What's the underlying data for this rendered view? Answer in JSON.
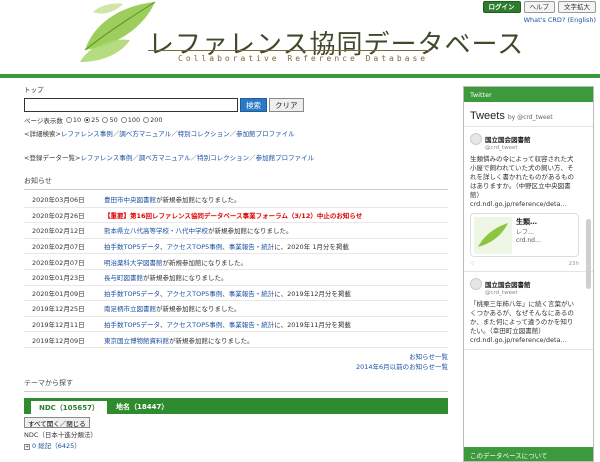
{
  "header": {
    "title": "レファレンス協同データベース",
    "subtitle": "Collaborative Reference Database",
    "login_label": "ログイン",
    "help_label": "ヘルプ",
    "font_size_label": "文字拡大",
    "whats_crd": "What's CRD? (English)"
  },
  "breadcrumb": "トップ",
  "search": {
    "placeholder": "",
    "search_label": "検索",
    "clear_label": "クリア",
    "per_page_label": "ページ表示数",
    "per_page_options": [
      "10",
      "25",
      "50",
      "100",
      "200"
    ],
    "per_page_selected": "25"
  },
  "detail_search": {
    "prefix": "<詳細検索>",
    "links": [
      "レファレンス事例",
      "調べ方マニュアル",
      "特別コレクション",
      "参加館プロファイル"
    ]
  },
  "register_data": {
    "prefix": "<登録データ一覧>",
    "links": [
      "レファレンス事例",
      "調べ方マニュアル",
      "特別コレクション",
      "参加館プロファイル"
    ]
  },
  "news": {
    "title": "お知らせ",
    "items": [
      {
        "date": "2020年03月06日",
        "link": "豊田市中央図書館",
        "text": "が新規参加館になりました。",
        "red": false
      },
      {
        "date": "2020年02月26日",
        "link": "",
        "text": "【重要】第16回レファレンス協同データベース事業フォーラム（3/12）中止のお知らせ",
        "red": true
      },
      {
        "date": "2020年02月12日",
        "link": "熊本県立八代高等学校・八代中学校",
        "text": "が新規参加館になりました。",
        "red": false
      },
      {
        "date": "2020年02月07日",
        "link": "",
        "text": "",
        "red": false
      },
      {
        "date": "2020年02月07日",
        "link": "明治薬科大学図書館",
        "text": "が新規参加館になりました。",
        "red": false
      },
      {
        "date": "2020年01月23日",
        "link": "長与町図書館",
        "text": "が新規参加館になりました。",
        "red": false
      },
      {
        "date": "2020年01月09日",
        "link": "",
        "text": "",
        "red": false
      },
      {
        "date": "2019年12月25日",
        "link": "南足柄市立図書館",
        "text": "が新規参加館になりました。",
        "red": false
      },
      {
        "date": "2019年12月11日",
        "link": "",
        "text": "",
        "red": false
      },
      {
        "date": "2019年12月09日",
        "link": "東京国立博物館資料館",
        "text": "が新規参加館になりました。",
        "red": false
      }
    ],
    "stats_rows": {
      "row4": {
        "links": [
          "拍手数TOP5データ",
          "アクセスTOP5事例",
          "事業報告・統計"
        ],
        "suffix": "に、2020年 1月分を掲載"
      },
      "row7": {
        "links": [
          "拍手数TOP5データ",
          "アクセスTOP5事例",
          "事業報告・統計"
        ],
        "suffix": "に、2019年12月分を掲載"
      },
      "row9": {
        "links": [
          "拍手数TOP5データ",
          "アクセスTOP5事例",
          "事業報告・統計"
        ],
        "suffix": "に、2019年11月分を掲載"
      }
    },
    "list_link": "お知らせ一覧",
    "old_link": "2014年6月以前のお知らせ一覧"
  },
  "topics": {
    "title": "テーマから探す",
    "tabs": [
      {
        "label": "NDC（105657）"
      },
      {
        "label": "地名（18447）"
      }
    ],
    "expand_label": "すべて開く／閉じる",
    "ndc_label": "NDC（日本十進分類法）",
    "first_item": "0 総記（6425）"
  },
  "twitter": {
    "header": "Twitter",
    "title": "Tweets",
    "by": "by @crd_tweet",
    "tweets": [
      {
        "name": "国立国会図書館",
        "handle": "@crd_tweet",
        "text": "生類憐みの令によって収容された犬小屋で飼われていた犬の飼い方、それを詳しく書かれたものがあるものはありますか。（中野区立中央図書館）crd.ndl.go.jp/reference/deta…",
        "card_title": "生類…",
        "card_desc": "レフ…\ncrd.nd…",
        "time": "23h"
      },
      {
        "name": "国立国会図書館",
        "handle": "@crd_tweet",
        "text": "「桃栗三年柿八年」に続く言葉がいくつかあるが、なぜそんなにあるのか、また何によって違うのかを知りたい。（幸田町立図書館）crd.ndl.go.jp/reference/deta…",
        "card_title": "",
        "card_desc": "",
        "time": ""
      }
    ],
    "bottom_label": "このデータベースについて"
  }
}
